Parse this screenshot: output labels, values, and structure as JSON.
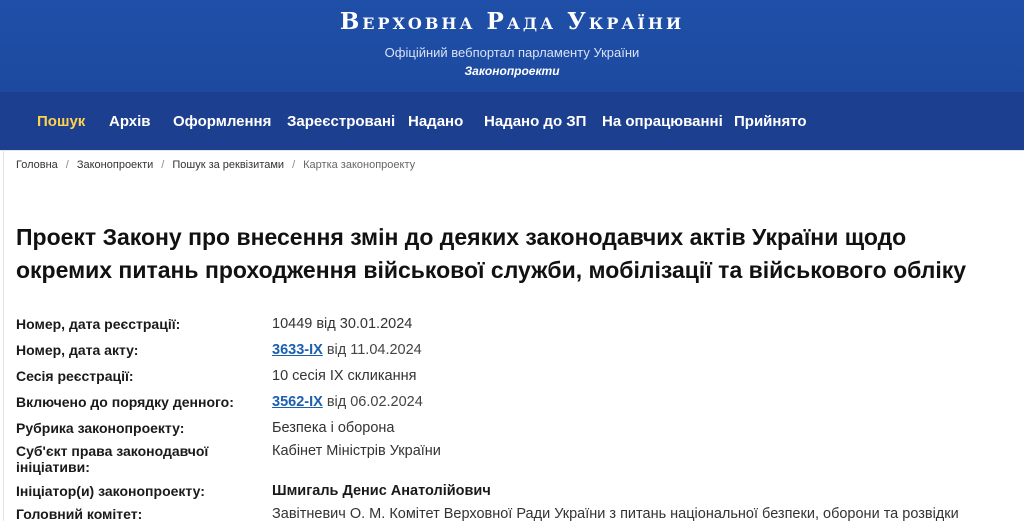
{
  "header": {
    "title": "Верховна Рада України",
    "subtitle": "Офіційний вебпортал парламенту України",
    "section": "Законопроекти"
  },
  "nav": [
    {
      "label": "Пошук",
      "active": true
    },
    {
      "label": "Архів"
    },
    {
      "label": "Оформлення"
    },
    {
      "label": "Зареєстровані"
    },
    {
      "label": "Надано"
    },
    {
      "label": "Надано до ЗП"
    },
    {
      "label": "На опрацюванні"
    },
    {
      "label": "Прийнято"
    }
  ],
  "breadcrumb": [
    "Головна",
    "Законопроекти",
    "Пошук за реквізитами",
    "Картка законопроекту"
  ],
  "title": "Проект Закону про внесення змін до деяких законодавчих актів України щодо окремих питань проходження військової служби, мобілізації та військового обліку",
  "fields": {
    "reg": {
      "label": "Номер, дата реєстрації:",
      "value": "10449 від 30.01.2024"
    },
    "act": {
      "label": "Номер, дата акту:",
      "link": "3633-IX",
      "rest": " від 11.04.2024"
    },
    "session": {
      "label": "Сесія реєстрації:",
      "value": "10 сесія IX скликання"
    },
    "agenda": {
      "label": "Включено до порядку денного:",
      "link": "3562-IX",
      "rest": " від 06.02.2024"
    },
    "rubric": {
      "label": "Рубрика законопроекту:",
      "value": "Безпека і оборона"
    },
    "subject": {
      "label": "Суб'єкт права законодавчої ініціативи:",
      "value": "Кабінет Міністрів України"
    },
    "initiator": {
      "label": "Ініціатор(и) законопроекту:",
      "value": "Шмигаль Денис Анатолійович"
    },
    "committee": {
      "label": "Головний комітет:",
      "value": "Завітневич О. М. Комітет Верховної Ради України з питань національної безпеки, оборони та розвідки"
    }
  }
}
